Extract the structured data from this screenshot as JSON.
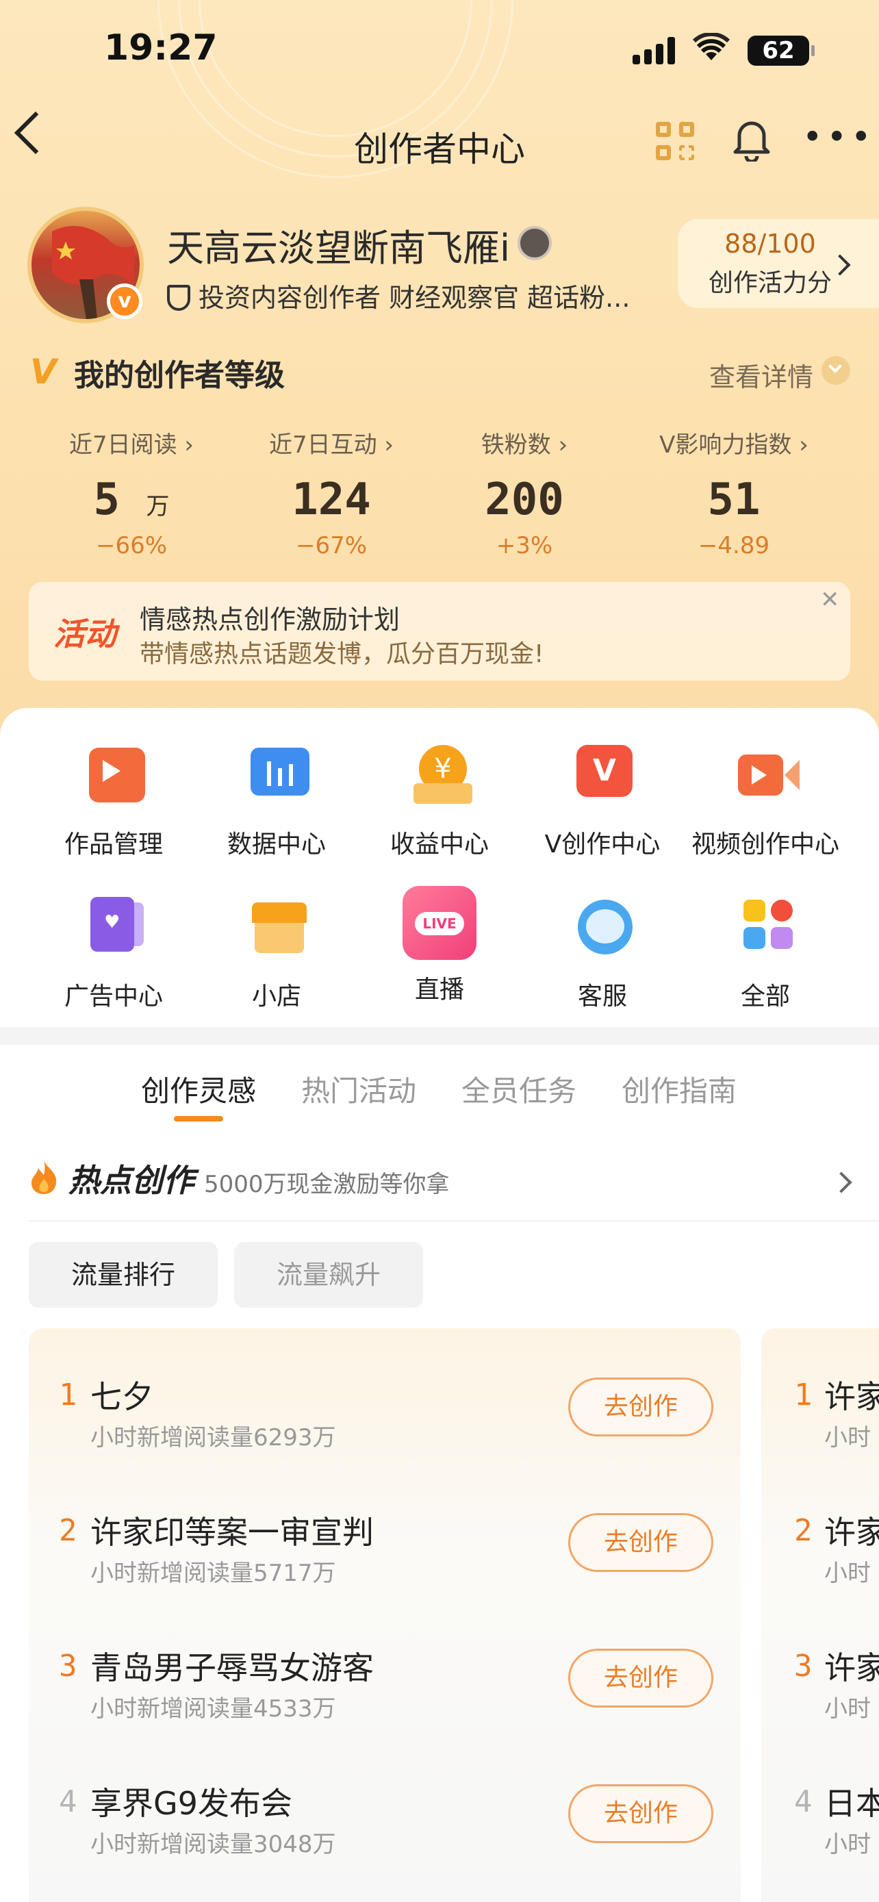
{
  "status_bar": {
    "time": "19:27",
    "battery": "62"
  },
  "nav": {
    "title": "创作者中心"
  },
  "profile": {
    "name": "天高云淡望断南飞雁i",
    "tags": "投资内容创作者 财经观察官 超话粉...",
    "score": "88/100",
    "score_label": "创作活力分"
  },
  "level": {
    "title": "我的创作者等级",
    "detail_label": "查看详情"
  },
  "stats": [
    {
      "label": "近7日阅读",
      "value": "5",
      "unit": "万",
      "change": "−66%"
    },
    {
      "label": "近7日互动",
      "value": "124",
      "unit": "",
      "change": "−67%"
    },
    {
      "label": "铁粉数",
      "value": "200",
      "unit": "",
      "change": "+3%"
    },
    {
      "label": "V影响力指数",
      "value": "51",
      "unit": "",
      "change": "−4.89"
    }
  ],
  "banner": {
    "tag": "活动",
    "title": "情感热点创作激励计划",
    "subtitle": "带情感热点话题发博，瓜分百万现金!"
  },
  "tools": [
    {
      "label": "作品管理",
      "icon": "works-icon"
    },
    {
      "label": "数据中心",
      "icon": "data-icon"
    },
    {
      "label": "收益中心",
      "icon": "income-icon"
    },
    {
      "label": "V创作中心",
      "icon": "v-create-icon"
    },
    {
      "label": "视频创作中心",
      "icon": "video-icon"
    },
    {
      "label": "广告中心",
      "icon": "ad-icon"
    },
    {
      "label": "小店",
      "icon": "shop-icon"
    },
    {
      "label": "直播",
      "icon": "live-icon",
      "badge": "LIVE"
    },
    {
      "label": "客服",
      "icon": "support-icon"
    },
    {
      "label": "全部",
      "icon": "all-icon"
    }
  ],
  "tabs": [
    "创作灵感",
    "热门活动",
    "全员任务",
    "创作指南"
  ],
  "hot": {
    "title": "热点创作",
    "subtitle": "5000万现金激励等你拿"
  },
  "chips": [
    "流量排行",
    "流量飙升"
  ],
  "list_button": "去创作",
  "list": [
    {
      "rank": "1",
      "title": "七夕",
      "sub": "小时新增阅读量6293万"
    },
    {
      "rank": "2",
      "title": "许家印等案一审宣判",
      "sub": "小时新增阅读量5717万"
    },
    {
      "rank": "3",
      "title": "青岛男子辱骂女游客",
      "sub": "小时新增阅读量4533万"
    },
    {
      "rank": "4",
      "title": "享界G9发布会",
      "sub": "小时新增阅读量3048万"
    }
  ],
  "peek_list": [
    {
      "rank": "1",
      "title": "许家",
      "sub": "小时"
    },
    {
      "rank": "2",
      "title": "许家",
      "sub": "小时"
    },
    {
      "rank": "3",
      "title": "许家",
      "sub": "小时"
    },
    {
      "rank": "4",
      "title": "日本",
      "sub": "小时"
    }
  ],
  "colors": {
    "accent": "#f58a1f",
    "rank_top": "#f07a22",
    "rank_other": "#b5b5b5",
    "header_bg": "#fde2b0"
  }
}
